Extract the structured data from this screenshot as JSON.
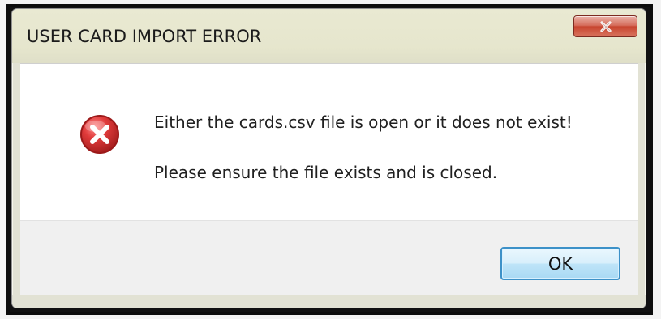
{
  "dialog": {
    "title": "USER CARD IMPORT ERROR",
    "close_icon": "close-icon",
    "message_line_1": "Either the cards.csv file is open or it does not exist!",
    "message_line_2": "Please ensure the file exists and is closed.",
    "error_icon": "error-icon",
    "ok_button_label": "OK"
  },
  "colors": {
    "title_bar": "#e6e6cd",
    "close_button": "#d66f5e",
    "error_icon": "#c92f2f",
    "ok_button_border": "#3d91c8"
  }
}
